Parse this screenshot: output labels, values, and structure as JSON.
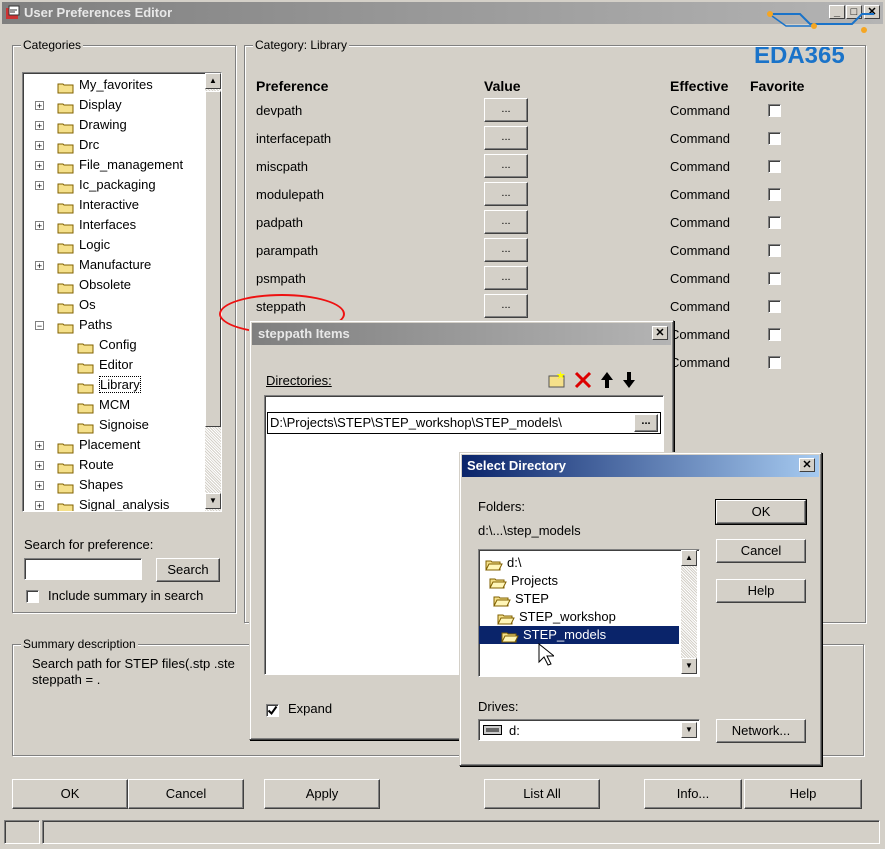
{
  "main_window": {
    "title": "User Preferences Editor",
    "categories_label": "Categories",
    "category_prefix": "Category:",
    "category_name": "Library",
    "tree": [
      {
        "label": "My_favorites",
        "expander": ""
      },
      {
        "label": "Display",
        "expander": "+"
      },
      {
        "label": "Drawing",
        "expander": "+"
      },
      {
        "label": "Drc",
        "expander": "+"
      },
      {
        "label": "File_management",
        "expander": "+"
      },
      {
        "label": "Ic_packaging",
        "expander": "+"
      },
      {
        "label": "Interactive",
        "expander": ""
      },
      {
        "label": "Interfaces",
        "expander": "+"
      },
      {
        "label": "Logic",
        "expander": ""
      },
      {
        "label": "Manufacture",
        "expander": "+"
      },
      {
        "label": "Obsolete",
        "expander": ""
      },
      {
        "label": "Os",
        "expander": ""
      },
      {
        "label": "Paths",
        "expander": "-"
      },
      {
        "label": "Config",
        "expander": "",
        "child": true
      },
      {
        "label": "Editor",
        "expander": "",
        "child": true
      },
      {
        "label": "Library",
        "expander": "",
        "child": true
      },
      {
        "label": "MCM",
        "expander": "",
        "child": true
      },
      {
        "label": "Signoise",
        "expander": "",
        "child": true
      },
      {
        "label": "Placement",
        "expander": "+"
      },
      {
        "label": "Route",
        "expander": "+"
      },
      {
        "label": "Shapes",
        "expander": "+"
      },
      {
        "label": "Signal_analysis",
        "expander": "+"
      }
    ],
    "columns": {
      "preference": "Preference",
      "value": "Value",
      "effective": "Effective",
      "favorite": "Favorite"
    },
    "preferences": [
      {
        "name": "devpath",
        "value": "...",
        "effective": "Command"
      },
      {
        "name": "interfacepath",
        "value": "...",
        "effective": "Command"
      },
      {
        "name": "miscpath",
        "value": "...",
        "effective": "Command"
      },
      {
        "name": "modulepath",
        "value": "...",
        "effective": "Command"
      },
      {
        "name": "padpath",
        "value": "...",
        "effective": "Command"
      },
      {
        "name": "parampath",
        "value": "...",
        "effective": "Command"
      },
      {
        "name": "psmpath",
        "value": "...",
        "effective": "Command"
      },
      {
        "name": "steppath",
        "value": "...",
        "effective": "Command"
      },
      {
        "name": "",
        "value": "",
        "effective": "Command"
      },
      {
        "name": "",
        "value": "",
        "effective": "Command"
      }
    ],
    "search_label": "Search for preference:",
    "search_value": "",
    "search_button": "Search",
    "include_summary_label": "Include summary in search",
    "summary_label": "Summary description",
    "summary_line1": "Search path for STEP files(.stp .ste",
    "summary_line2": "steppath = .",
    "buttons": {
      "ok": "OK",
      "cancel": "Cancel",
      "apply": "Apply",
      "list_all": "List All",
      "info": "Info...",
      "help": "Help"
    }
  },
  "watermark": {
    "text": "EDA365",
    "color": "#1a73c9"
  },
  "steppath_dialog": {
    "title": "steppath Items",
    "directories_label": "Directories:",
    "entry": "D:\\Projects\\STEP\\STEP_workshop\\STEP_models\\",
    "browse": "...",
    "expand_label": "Expand"
  },
  "select_dialog": {
    "title": "Select Directory",
    "folders_label": "Folders:",
    "current_path": "d:\\...\\step_models",
    "folders": [
      {
        "label": "d:\\",
        "indent": 0,
        "selected": false
      },
      {
        "label": "Projects",
        "indent": 1,
        "selected": false
      },
      {
        "label": "STEP",
        "indent": 2,
        "selected": false
      },
      {
        "label": "STEP_workshop",
        "indent": 3,
        "selected": false
      },
      {
        "label": "STEP_models",
        "indent": 4,
        "selected": true
      }
    ],
    "drives_label": "Drives:",
    "drive_value": "d:",
    "buttons": {
      "ok": "OK",
      "cancel": "Cancel",
      "help": "Help",
      "network": "Network..."
    }
  },
  "colors": {
    "selection": "#0a246a",
    "annotation": "#e11111",
    "folder": "#f5e08a"
  }
}
